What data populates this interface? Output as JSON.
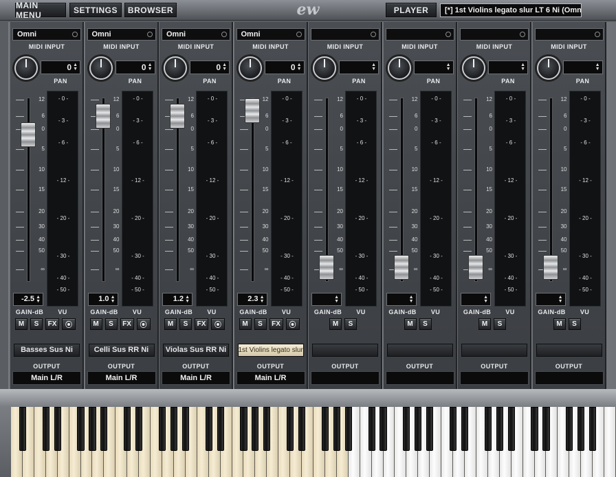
{
  "toolbar": {
    "main_menu": "MAIN MENU",
    "settings": "SETTINGS",
    "browser": "BROWSER",
    "player": "PLAYER",
    "logo": "ew",
    "instrument": "[*] 1st Violins legato slur LT 6 Ni (Omni)"
  },
  "labels": {
    "midi_input": "MIDI INPUT",
    "pan": "PAN",
    "gain": "GAIN-dB",
    "vu": "VU",
    "output": "OUTPUT",
    "mute": "M",
    "solo": "S",
    "fx": "FX",
    "eq": "⦿"
  },
  "fader_scale": [
    "12",
    "6",
    "0",
    "5",
    "10",
    "15",
    "20",
    "30",
    "40",
    "50",
    "∞"
  ],
  "vu_scale": [
    "0",
    "3",
    "6",
    "12",
    "20",
    "30",
    "40",
    "50"
  ],
  "channels": [
    {
      "midi": "Omni",
      "pan": "0",
      "gain": "-2.5",
      "fader": 0.2,
      "patch": "Basses Sus Ni",
      "output": "Main L/R",
      "fx": true,
      "active": false
    },
    {
      "midi": "Omni",
      "pan": "0",
      "gain": "1.0",
      "fader": 0.1,
      "patch": "Celli Sus RR Ni",
      "output": "Main L/R",
      "fx": true,
      "active": false
    },
    {
      "midi": "Omni",
      "pan": "0",
      "gain": "1.2",
      "fader": 0.1,
      "patch": "Violas Sus RR Ni",
      "output": "Main L/R",
      "fx": true,
      "active": false
    },
    {
      "midi": "Omni",
      "pan": "0",
      "gain": "2.3",
      "fader": 0.07,
      "patch": "1st Violins legato slur...",
      "output": "Main L/R",
      "fx": true,
      "active": true
    },
    {
      "midi": "",
      "pan": "",
      "gain": "",
      "fader": 0.92,
      "patch": "",
      "output": "",
      "fx": false,
      "active": false
    },
    {
      "midi": "",
      "pan": "",
      "gain": "",
      "fader": 0.92,
      "patch": "",
      "output": "",
      "fx": false,
      "active": false
    },
    {
      "midi": "",
      "pan": "",
      "gain": "",
      "fader": 0.92,
      "patch": "",
      "output": "",
      "fx": false,
      "active": false
    },
    {
      "midi": "",
      "pan": "",
      "gain": "",
      "fader": 0.92,
      "patch": "",
      "output": "",
      "fx": false,
      "active": false
    }
  ],
  "keyboard": {
    "white_keys": 52,
    "highlight_from_key": 29
  }
}
